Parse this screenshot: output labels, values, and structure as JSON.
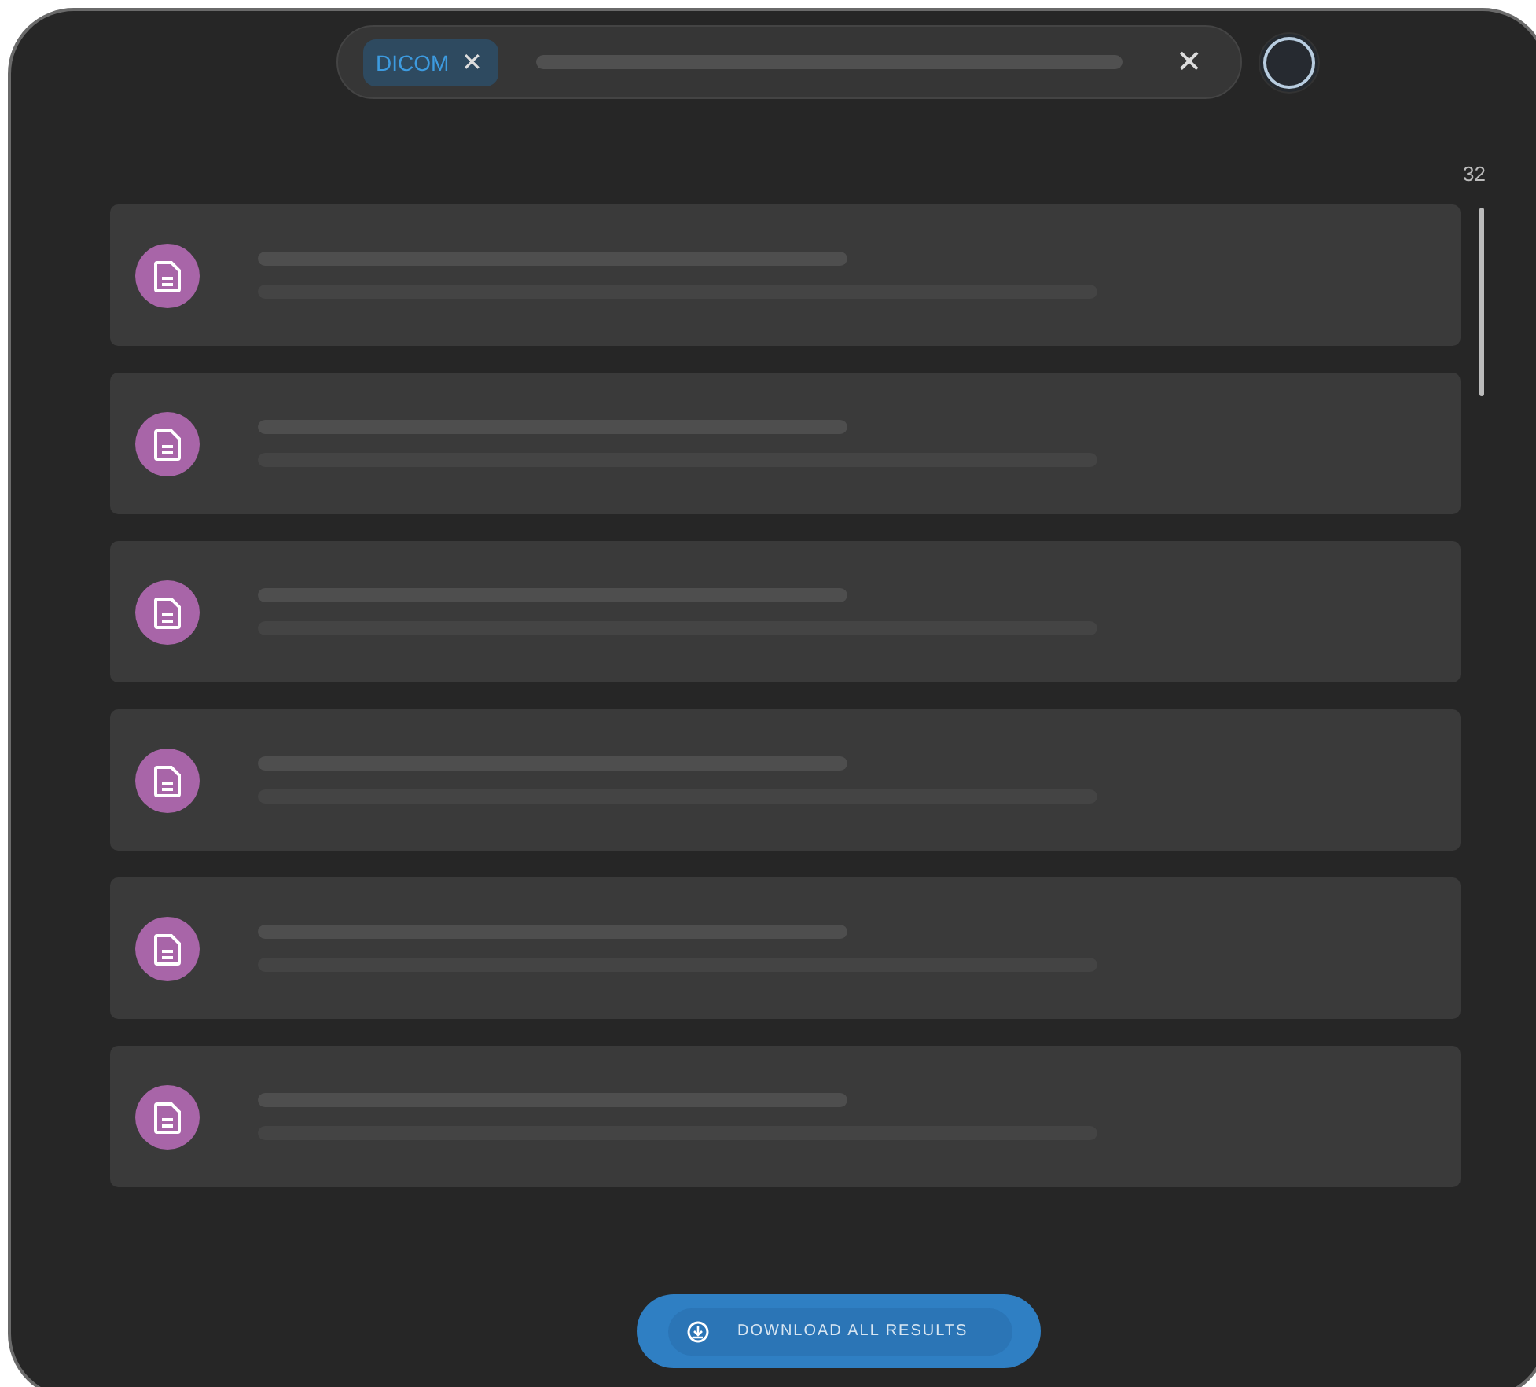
{
  "search": {
    "chips": [
      {
        "label": "DICOM",
        "remove": "✕"
      }
    ],
    "clear": "✕"
  },
  "count": "32",
  "results": [
    {
      "kind": "document"
    },
    {
      "kind": "document"
    },
    {
      "kind": "document"
    },
    {
      "kind": "document"
    },
    {
      "kind": "document"
    },
    {
      "kind": "document"
    }
  ],
  "download_button": {
    "label": "DOWNLOAD ALL RESULTS"
  }
}
